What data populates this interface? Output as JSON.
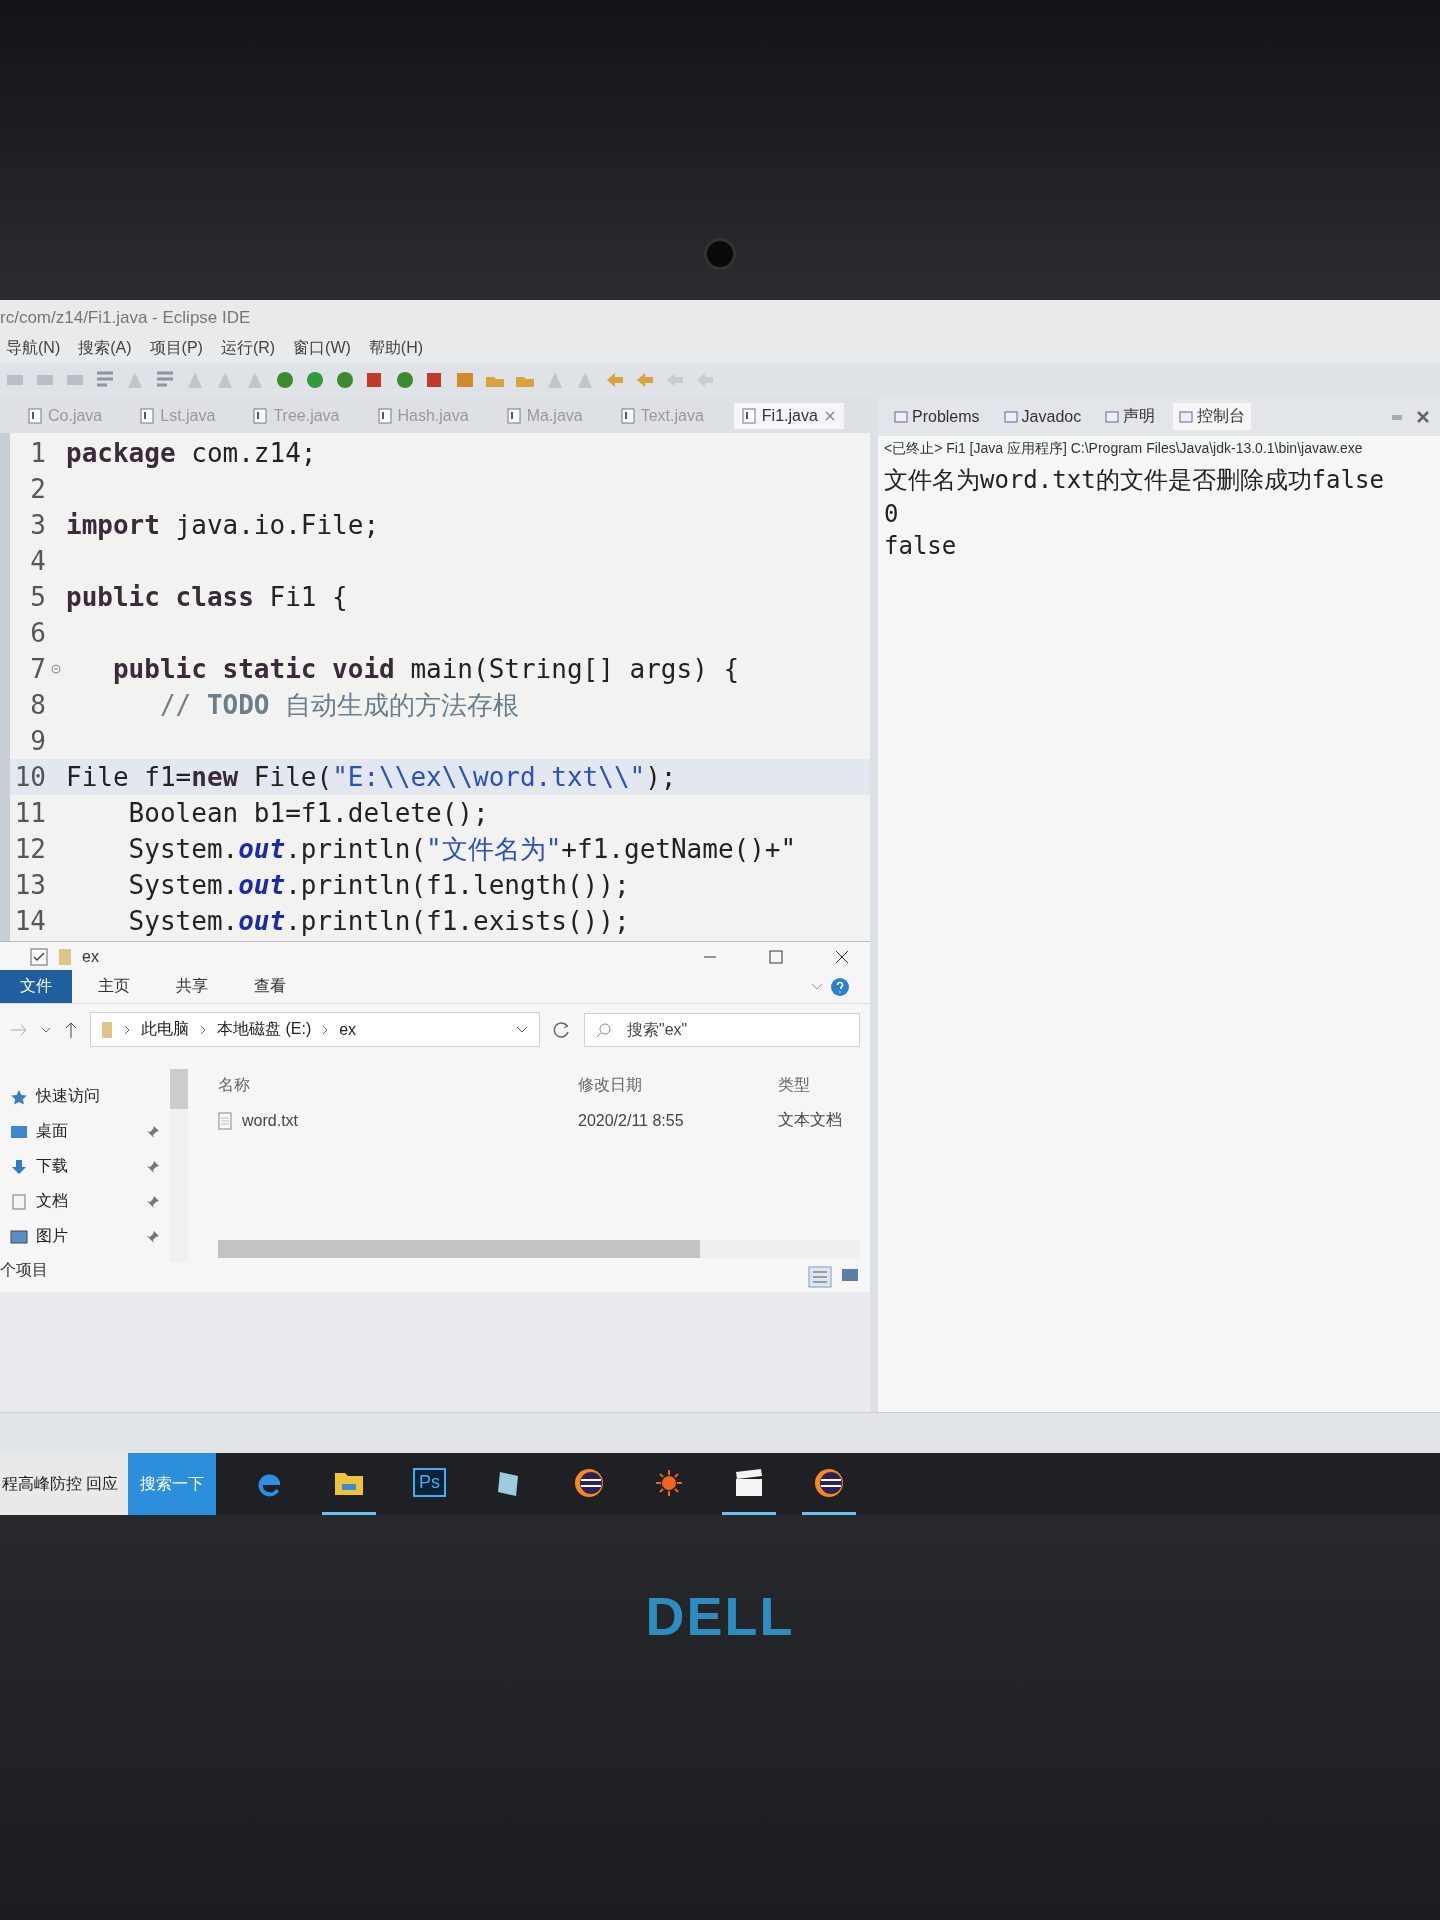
{
  "window": {
    "title": "rc/com/z14/Fi1.java - Eclipse IDE"
  },
  "menu": [
    "导航(N)",
    "搜索(A)",
    "项目(P)",
    "运行(R)",
    "窗口(W)",
    "帮助(H)"
  ],
  "editor_tabs": [
    {
      "label": "Co.java",
      "selected": false
    },
    {
      "label": "Lst.java",
      "selected": false
    },
    {
      "label": "Tree.java",
      "selected": false
    },
    {
      "label": "Hash.java",
      "selected": false
    },
    {
      "label": "Ma.java",
      "selected": false
    },
    {
      "label": "Text.java",
      "selected": false
    },
    {
      "label": "Fi1.java",
      "selected": true
    }
  ],
  "code_lines": [
    {
      "number": "1",
      "current": false,
      "fold": false,
      "tokens": [
        {
          "kind": "kw",
          "text": "package"
        },
        {
          "kind": "plain",
          "text": " com.z14;"
        }
      ]
    },
    {
      "number": "2",
      "current": false,
      "fold": false
    },
    {
      "number": "3",
      "current": false,
      "fold": false,
      "tokens": [
        {
          "kind": "kw",
          "text": "import"
        },
        {
          "kind": "plain",
          "text": " java.io.File;"
        }
      ]
    },
    {
      "number": "4",
      "current": false,
      "fold": false
    },
    {
      "number": "5",
      "current": false,
      "fold": false,
      "tokens": [
        {
          "kind": "kw",
          "text": "public class"
        },
        {
          "kind": "plain",
          "text": " Fi1 {"
        }
      ]
    },
    {
      "number": "6",
      "current": false,
      "fold": false
    },
    {
      "number": "7",
      "current": false,
      "fold": true,
      "tokens": [
        {
          "kind": "kw",
          "text": "   public static void"
        },
        {
          "kind": "plain",
          "text": " main(String[] args) {"
        }
      ]
    },
    {
      "number": "8",
      "current": false,
      "fold": false,
      "tokens": [
        {
          "kind": "comment",
          "text": "      // "
        },
        {
          "kind": "todo",
          "text": "TODO"
        },
        {
          "kind": "comment",
          "text": " 自动生成的方法存根"
        }
      ]
    },
    {
      "number": "9",
      "current": false,
      "fold": false
    },
    {
      "number": "10",
      "current": true,
      "fold": false,
      "tokens": [
        {
          "kind": "plain",
          "text": "File f1="
        },
        {
          "kind": "kw",
          "text": "new"
        },
        {
          "kind": "plain",
          "text": " File("
        },
        {
          "kind": "str",
          "text": "\"E:\\\\ex\\\\word.txt\\\\\""
        },
        {
          "kind": "plain",
          "text": ");"
        }
      ]
    },
    {
      "number": "11",
      "current": false,
      "fold": false,
      "tokens": [
        {
          "kind": "plain",
          "text": "    Boolean b1=f1.delete();"
        }
      ]
    },
    {
      "number": "12",
      "current": false,
      "fold": false,
      "tokens": [
        {
          "kind": "plain",
          "text": "    System."
        },
        {
          "kind": "field",
          "text": "out"
        },
        {
          "kind": "plain",
          "text": ".println("
        },
        {
          "kind": "str",
          "text": "\"文件名为\""
        },
        {
          "kind": "plain",
          "text": "+f1.getName()+\""
        }
      ]
    },
    {
      "number": "13",
      "current": false,
      "fold": false,
      "tokens": [
        {
          "kind": "plain",
          "text": "    System."
        },
        {
          "kind": "field",
          "text": "out"
        },
        {
          "kind": "plain",
          "text": ".println(f1.length());"
        }
      ]
    },
    {
      "number": "14",
      "current": false,
      "fold": false,
      "tokens": [
        {
          "kind": "plain",
          "text": "    System."
        },
        {
          "kind": "field",
          "text": "out"
        },
        {
          "kind": "plain",
          "text": ".println(f1.exists());"
        }
      ]
    }
  ],
  "console": {
    "tabs": [
      {
        "label": "Problems",
        "selected": false
      },
      {
        "label": "Javadoc",
        "selected": false
      },
      {
        "label": "声明",
        "selected": false
      },
      {
        "label": "控制台",
        "selected": true
      }
    ],
    "header": "<已终止> Fi1 [Java 应用程序] C:\\Program Files\\Java\\jdk-13.0.1\\bin\\javaw.exe",
    "output": [
      "文件名为word.txt的文件是否删除成功false",
      "0",
      "false"
    ]
  },
  "explorer": {
    "title": "ex",
    "ribbon_tabs": [
      {
        "label": "文件",
        "selected": true
      },
      {
        "label": "主页",
        "selected": false
      },
      {
        "label": "共享",
        "selected": false
      },
      {
        "label": "查看",
        "selected": false
      }
    ],
    "breadcrumb": [
      "此电脑",
      "本地磁盘 (E:)",
      "ex"
    ],
    "search": {
      "placeholder": "搜索\"ex\""
    },
    "nav": [
      {
        "label": "快速访问",
        "kind": "star",
        "pinned": false
      },
      {
        "label": "桌面",
        "kind": "desktop",
        "pinned": true
      },
      {
        "label": "下载",
        "kind": "download",
        "pinned": true
      },
      {
        "label": "文档",
        "kind": "document",
        "pinned": true
      },
      {
        "label": "图片",
        "kind": "picture",
        "pinned": true
      }
    ],
    "columns": [
      "名称",
      "修改日期",
      "类型"
    ],
    "files": [
      {
        "name": "word.txt",
        "modified": "2020/2/11 8:55",
        "type": "文本文档"
      }
    ],
    "status": "个项目"
  },
  "taskbar": {
    "news": "程高峰防控 回应",
    "search_button": "搜索一下",
    "apps": [
      {
        "kind": "edge",
        "open": false
      },
      {
        "kind": "folder",
        "open": true
      },
      {
        "kind": "ps",
        "label": "Ps",
        "open": false
      },
      {
        "kind": "book",
        "open": false
      },
      {
        "kind": "eclipse",
        "open": false
      },
      {
        "kind": "sun",
        "open": false
      },
      {
        "kind": "clapper",
        "open": true
      },
      {
        "kind": "eclipse",
        "open": true
      }
    ]
  },
  "laptop_brand": "DELL"
}
